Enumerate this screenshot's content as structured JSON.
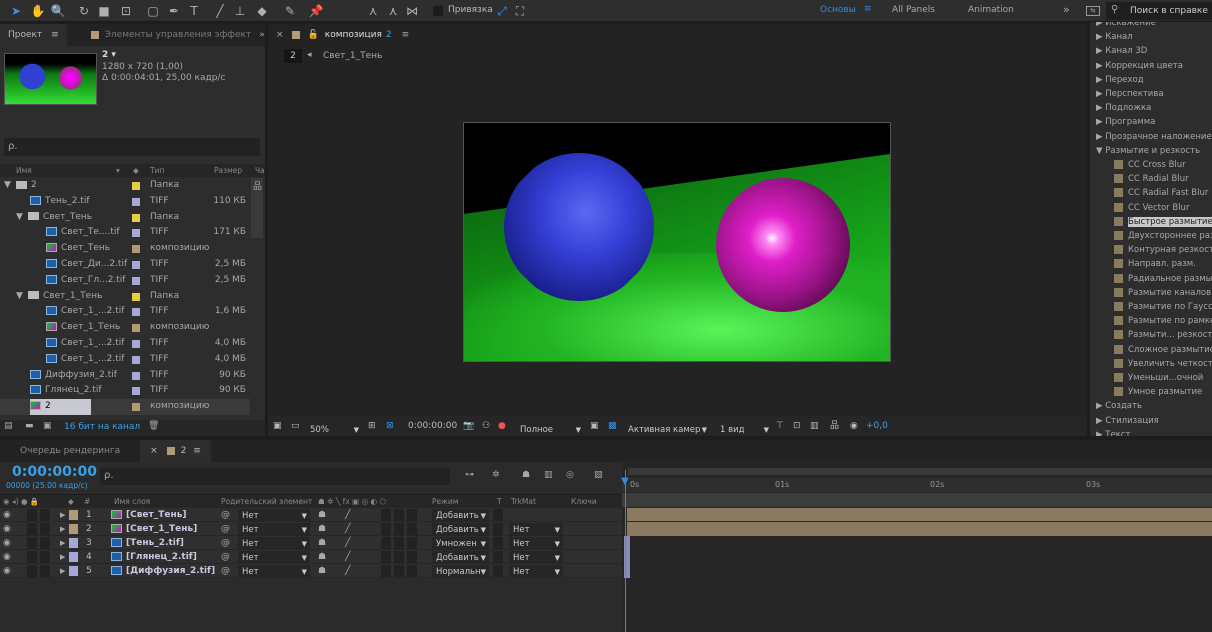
{
  "toolbar": {
    "snap_label": "Привязка",
    "workspaces": [
      "Основы",
      "All Panels",
      "Animation"
    ],
    "more": "»",
    "search_placeholder": "Поиск в справке"
  },
  "project": {
    "tab": "Проект",
    "tab2": "Элементы управления эффект",
    "more": "»",
    "comp_name": "2 ▾",
    "comp_size": "1280 x 720 (1,00)",
    "comp_duration": "Δ 0:00:04:01, 25,00 кадр/с",
    "search_placeholder": "ρ.",
    "columns": [
      "Имя",
      "Тип",
      "Размер",
      "Ча"
    ],
    "items": [
      {
        "name": "2",
        "type": "Папка",
        "size": "",
        "icon": "folder",
        "indent": 0,
        "color": "#e3cc4a",
        "arrow": "▼"
      },
      {
        "name": "Тень_2.tif",
        "type": "TIFF",
        "size": "110 КБ",
        "icon": "file",
        "indent": 2,
        "color": "#a8a8d8"
      },
      {
        "name": "Свет_Тень",
        "type": "Папка",
        "size": "",
        "icon": "folder",
        "indent": 1,
        "color": "#e3cc4a",
        "arrow": "▼"
      },
      {
        "name": "Свет_Те....tif",
        "type": "TIFF",
        "size": "171 КБ",
        "icon": "file",
        "indent": 3,
        "color": "#a8a8d8"
      },
      {
        "name": "Свет_Тень",
        "type": "композицию",
        "size": "",
        "icon": "comp",
        "indent": 3,
        "color": "#b09a7a"
      },
      {
        "name": "Свет_Ди...2.tif",
        "type": "TIFF",
        "size": "2,5 МБ",
        "icon": "file",
        "indent": 3,
        "color": "#a8a8d8"
      },
      {
        "name": "Свет_Гл...2.tif",
        "type": "TIFF",
        "size": "2,5 МБ",
        "icon": "file",
        "indent": 3,
        "color": "#a8a8d8"
      },
      {
        "name": "Свет_1_Тень",
        "type": "Папка",
        "size": "",
        "icon": "folder",
        "indent": 1,
        "color": "#e3cc4a",
        "arrow": "▼"
      },
      {
        "name": "Свет_1_...2.tif",
        "type": "TIFF",
        "size": "1,6 МБ",
        "icon": "file",
        "indent": 3,
        "color": "#a8a8d8"
      },
      {
        "name": "Свет_1_Тень",
        "type": "композицию",
        "size": "",
        "icon": "comp",
        "indent": 3,
        "color": "#b09a7a"
      },
      {
        "name": "Свет_1_...2.tif",
        "type": "TIFF",
        "size": "4,0 МБ",
        "icon": "file",
        "indent": 3,
        "color": "#a8a8d8"
      },
      {
        "name": "Свет_1_...2.tif",
        "type": "TIFF",
        "size": "4,0 МБ",
        "icon": "file",
        "indent": 3,
        "color": "#a8a8d8"
      },
      {
        "name": "Диффузия_2.tif",
        "type": "TIFF",
        "size": "90 КБ",
        "icon": "file",
        "indent": 2,
        "color": "#a8a8d8"
      },
      {
        "name": "Глянец_2.tif",
        "type": "TIFF",
        "size": "90 КБ",
        "icon": "file",
        "indent": 2,
        "color": "#a8a8d8"
      },
      {
        "name": "2",
        "type": "композицию",
        "size": "",
        "icon": "comp",
        "indent": 2,
        "color": "#b09a7a",
        "selected": true
      }
    ],
    "bit_depth": "16 бит на канал"
  },
  "viewer": {
    "tab": "композиция",
    "tab_num": "2",
    "breadcrumb_num": "2",
    "breadcrumb": "Свет_1_Тень",
    "zoom": "50%",
    "timecode": "0:00:00:00",
    "resolution": "Полное",
    "camera": "Активная камер",
    "views": "1 вид",
    "exposure": "+0,0"
  },
  "effects": {
    "items": [
      {
        "label": "Искажение",
        "type": "cat"
      },
      {
        "label": "Канал",
        "type": "cat"
      },
      {
        "label": "Канал 3D",
        "type": "cat"
      },
      {
        "label": "Коррекция цвета",
        "type": "cat"
      },
      {
        "label": "Переход",
        "type": "cat"
      },
      {
        "label": "Перспектива",
        "type": "cat"
      },
      {
        "label": "Подложка",
        "type": "cat"
      },
      {
        "label": "Программа",
        "type": "cat"
      },
      {
        "label": "Прозрачное наложение",
        "type": "cat"
      },
      {
        "label": "Размытие и резкость",
        "type": "open"
      },
      {
        "label": "CC Cross Blur",
        "type": "fx"
      },
      {
        "label": "CC Radial Blur",
        "type": "fx"
      },
      {
        "label": "CC Radial Fast Blur",
        "type": "fx"
      },
      {
        "label": "CC Vector Blur",
        "type": "fx"
      },
      {
        "label": "Быстрое размытие",
        "type": "fx",
        "selected": true
      },
      {
        "label": "Двухстороннее размытие",
        "type": "fx"
      },
      {
        "label": "Контурная резкость",
        "type": "fx"
      },
      {
        "label": "Направл. разм.",
        "type": "fx"
      },
      {
        "label": "Радиальное размытие",
        "type": "fx"
      },
      {
        "label": "Размытие каналов",
        "type": "fx"
      },
      {
        "label": "Размытие по Гауссу",
        "type": "fx"
      },
      {
        "label": "Размытие по рамке",
        "type": "fx"
      },
      {
        "label": "Размыти... резкости",
        "type": "fx"
      },
      {
        "label": "Сложное размытие",
        "type": "fx"
      },
      {
        "label": "Увеличить четкость",
        "type": "fx"
      },
      {
        "label": "Уменьши...очной",
        "type": "fx"
      },
      {
        "label": "Умное размытие",
        "type": "fx"
      },
      {
        "label": "Создать",
        "type": "cat"
      },
      {
        "label": "Стилизация",
        "type": "cat"
      },
      {
        "label": "Текст",
        "type": "cat"
      }
    ]
  },
  "timeline": {
    "tab_render": "Очередь рендеринга",
    "tab_comp": "2",
    "timecode": "0:00:00:00",
    "frames": "00000 (25.00 кадр/с)",
    "search_placeholder": "ρ.",
    "columns": {
      "name": "Имя слоя",
      "parent": "Родительский элемент",
      "mode": "Режим",
      "t": "T",
      "trkmat": "TrkMat",
      "keys": "Ключи",
      "num": "#"
    },
    "ruler": [
      "0s",
      "01s",
      "02s",
      "03s"
    ],
    "layers": [
      {
        "num": "1",
        "name": "[Свет_Тень]",
        "icon": "comp",
        "color": "#b09a7a",
        "parent": "Нет",
        "mode": "Добавить",
        "trkmat": ""
      },
      {
        "num": "2",
        "name": "[Свет_1_Тень]",
        "icon": "comp",
        "color": "#b09a7a",
        "parent": "Нет",
        "mode": "Добавить",
        "trkmat": "Нет"
      },
      {
        "num": "3",
        "name": "[Тень_2.tif]",
        "icon": "file",
        "color": "#a8a8d8",
        "parent": "Нет",
        "mode": "Умножен",
        "trkmat": "Нет"
      },
      {
        "num": "4",
        "name": "[Глянец_2.tif]",
        "icon": "file",
        "color": "#a8a8d8",
        "parent": "Нет",
        "mode": "Добавить",
        "trkmat": "Нет"
      },
      {
        "num": "5",
        "name": "[Диффузия_2.tif]",
        "icon": "file",
        "color": "#a8a8d8",
        "parent": "Нет",
        "mode": "Нормальн",
        "trkmat": "Нет"
      }
    ]
  },
  "colors": {
    "accent": "#2d8ceb",
    "timecode": "#3aa0e6"
  }
}
